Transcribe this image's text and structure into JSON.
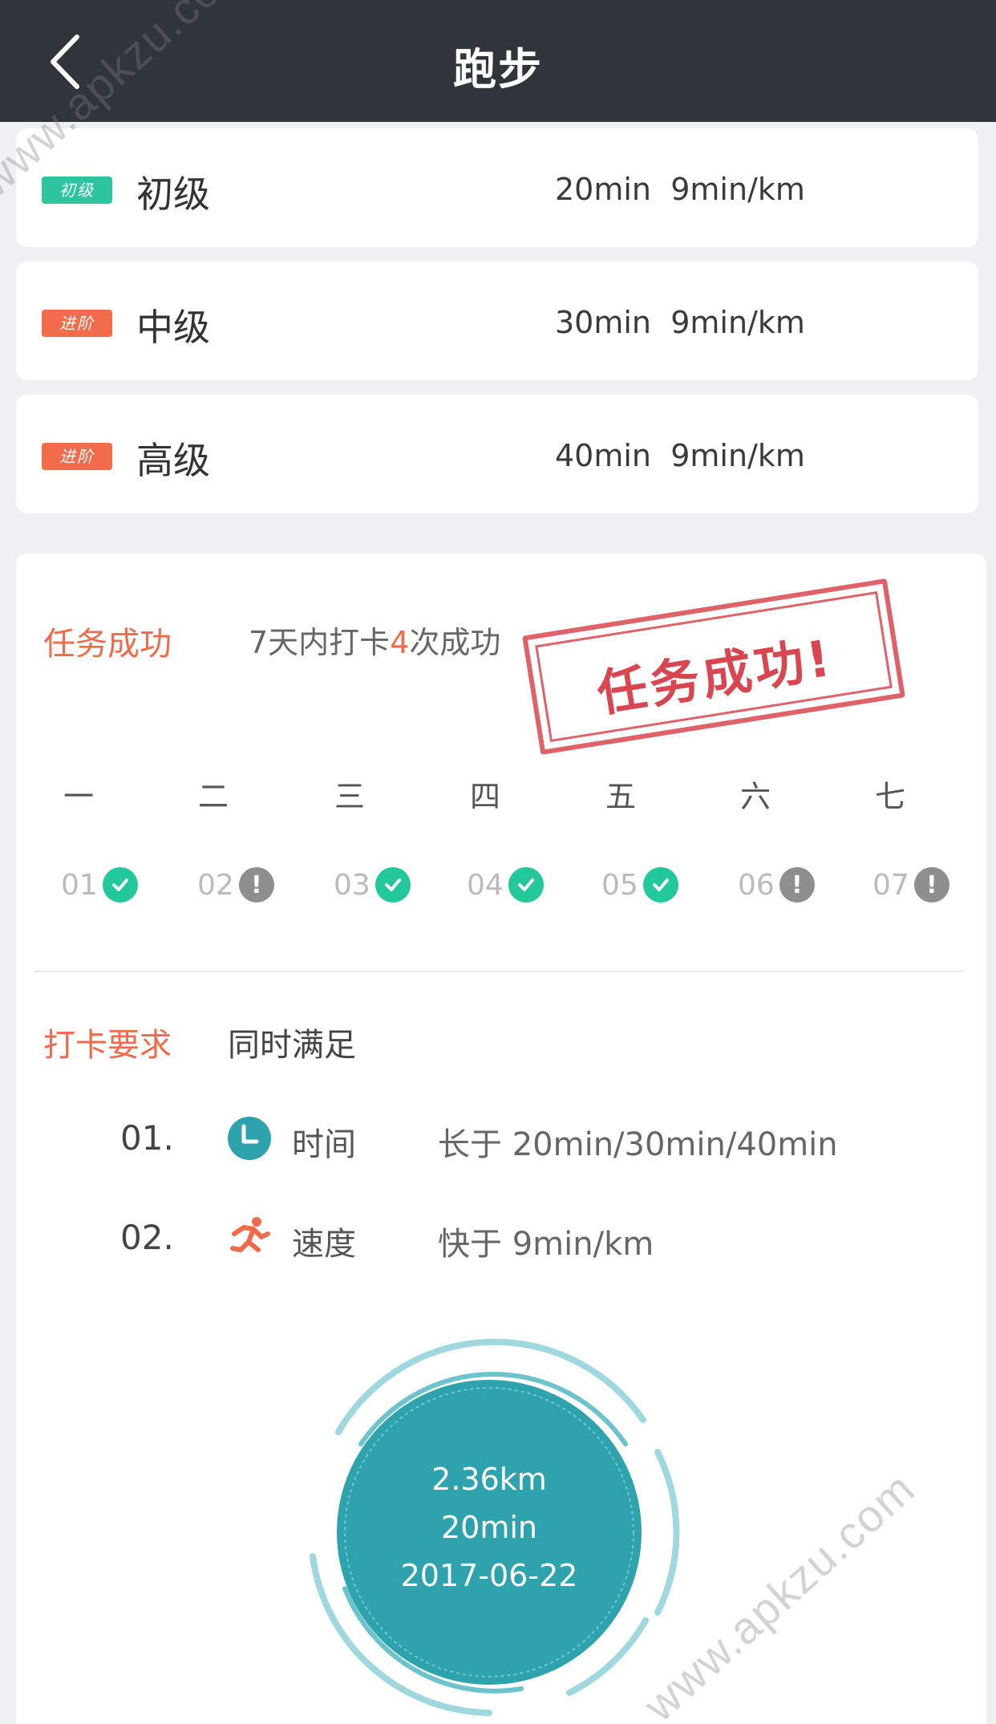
{
  "header": {
    "title": "跑步"
  },
  "levels": [
    {
      "badge": "初级",
      "badge_color": "#2ec4a0",
      "name": "初级",
      "duration": "20min",
      "pace": "9min/km"
    },
    {
      "badge": "进阶",
      "badge_color": "#f26b4a",
      "name": "中级",
      "duration": "30min",
      "pace": "9min/km"
    },
    {
      "badge": "进阶",
      "badge_color": "#f26b4a",
      "name": "高级",
      "duration": "40min",
      "pace": "9min/km"
    }
  ],
  "task": {
    "label": "任务成功",
    "desc_prefix": "7天内打卡",
    "desc_count": "4",
    "desc_suffix": "次成功",
    "stamp_text": "任务成功!"
  },
  "weekdays": [
    "一",
    "二",
    "三",
    "四",
    "五",
    "六",
    "七"
  ],
  "days": [
    {
      "num": "01",
      "status": "done"
    },
    {
      "num": "02",
      "status": "missed"
    },
    {
      "num": "03",
      "status": "done"
    },
    {
      "num": "04",
      "status": "done"
    },
    {
      "num": "05",
      "status": "done"
    },
    {
      "num": "06",
      "status": "missed"
    },
    {
      "num": "07",
      "status": "missed"
    }
  ],
  "requirements": {
    "label": "打卡要求",
    "desc": "同时满足",
    "items": [
      {
        "num": "01.",
        "icon": "clock-icon",
        "name": "时间",
        "value": "长于 20min/30min/40min"
      },
      {
        "num": "02.",
        "icon": "runner-icon",
        "name": "速度",
        "value": "快于 9min/km"
      }
    ]
  },
  "summary": {
    "distance": "2.36km",
    "duration": "20min",
    "date": "2017-06-22"
  },
  "watermark": "www.apkzu.com",
  "colors": {
    "accent": "#f06a4c",
    "success": "#22c79a",
    "ring": "#2fa3ad",
    "header_bg": "#30343b"
  }
}
